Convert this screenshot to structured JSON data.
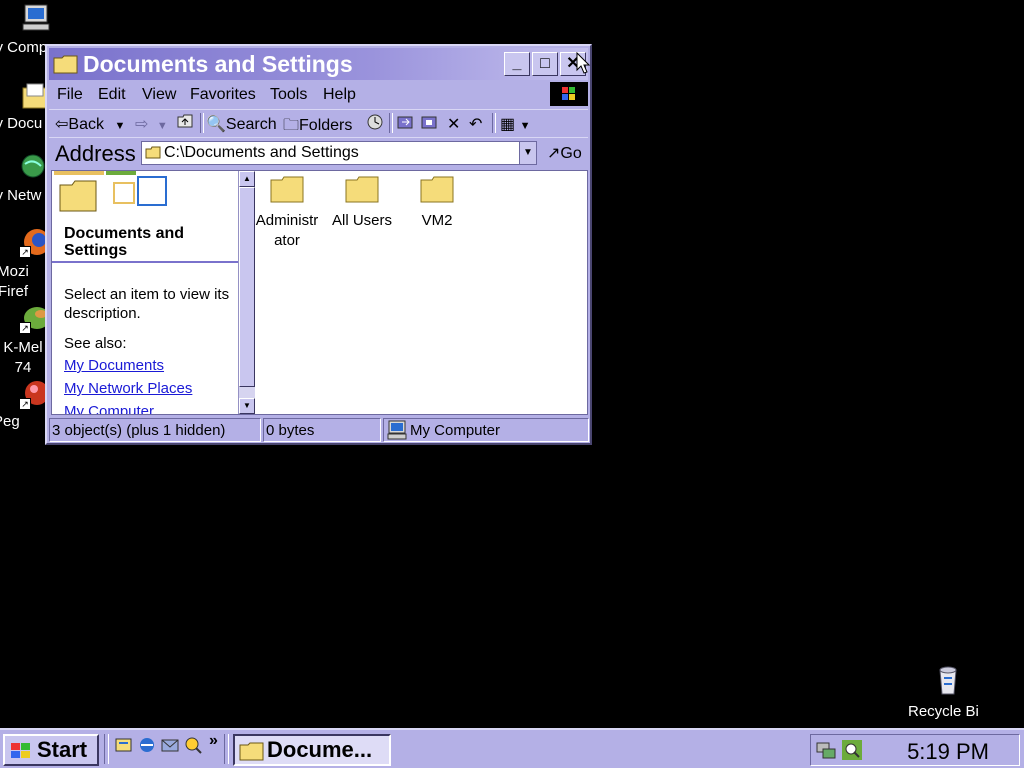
{
  "desktop": {
    "icons": [
      {
        "label": "My Comp",
        "icon": "my-computer-icon"
      },
      {
        "label": "My Docu",
        "icon": "my-documents-icon"
      },
      {
        "label": "My Netw",
        "icon": "my-network-icon"
      },
      {
        "label": "Mozi Firef",
        "icon": "firefox-icon"
      },
      {
        "label": "K-Mel 74",
        "icon": "k-meleon-icon"
      },
      {
        "label": "Peg",
        "icon": "pegasus-icon"
      }
    ],
    "recycle_bin": {
      "label": "Recycle Bi",
      "icon": "recycle-bin-icon"
    }
  },
  "window": {
    "title": "Documents and Settings",
    "caption": {
      "minimize": "_",
      "maximize": "□",
      "close": "✕"
    },
    "menu": [
      "File",
      "Edit",
      "View",
      "Favorites",
      "Tools",
      "Help"
    ],
    "toolbar": {
      "back": "Back",
      "forward": "⇨",
      "search": "Search",
      "folders": "Folders",
      "delete": "✕",
      "undo": "↶",
      "views": "▦"
    },
    "address": {
      "label": "Address",
      "value": "C:\\Documents and Settings",
      "go": "Go"
    },
    "left_pane": {
      "heading": "Documents and Settings",
      "description": "Select an item to view its description.",
      "see_also": "See also:",
      "links": [
        "My Documents",
        "My Network Places",
        "My Computer"
      ]
    },
    "files": [
      {
        "name": "Administr ator"
      },
      {
        "name": "All Users"
      },
      {
        "name": "VM2"
      }
    ],
    "status": {
      "objects": "3 object(s) (plus 1 hidden)",
      "size": "0 bytes",
      "zone": "My Computer"
    }
  },
  "taskbar": {
    "start": "Start",
    "more": "»",
    "task": "Docume...",
    "clock": "5:19 PM"
  },
  "colors": {
    "accent": "#7a72cc",
    "chrome": "#b4b0e6",
    "folder": "#f5dc7a",
    "link": "#1a1ad6"
  }
}
